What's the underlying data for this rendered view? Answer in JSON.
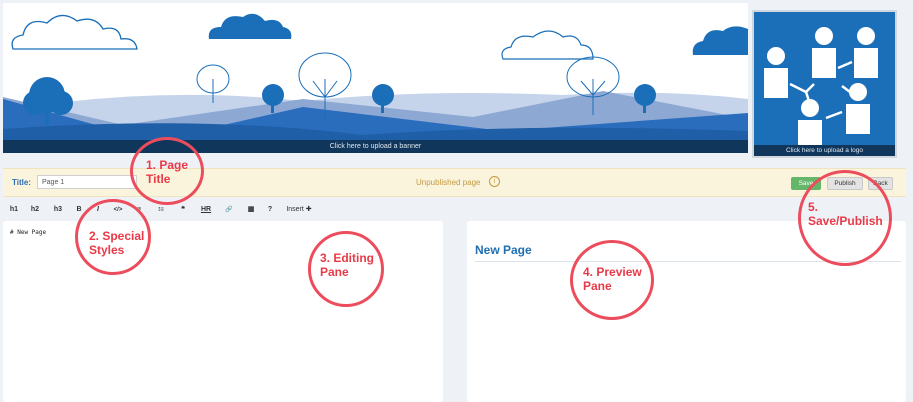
{
  "banner": {
    "upload_label": "Click here to upload a banner"
  },
  "logo": {
    "upload_label": "Click here to upload a logo"
  },
  "titlebar": {
    "label": "Title:",
    "title_value": "Page 1",
    "status": "Unpublished page",
    "info_icon": "i",
    "save_label": "Save",
    "publish_label": "Publish",
    "back_label": "Back"
  },
  "toolbar": {
    "items": [
      "h1",
      "h2",
      "h3",
      "B",
      "I",
      "</>",
      "≡",
      "⁝≡",
      "❝",
      "HR",
      "🔗",
      "▦",
      "?",
      "Insert ✚"
    ]
  },
  "editor": {
    "content": "# New Page"
  },
  "preview": {
    "heading": "New Page"
  },
  "annotations": {
    "a1": "1. Page\nTitle",
    "a2": "2. Special\nStyles",
    "a3": "3. Editing\nPane",
    "a4": "4. Preview\nPane",
    "a5": "5.\nSave/Publish"
  },
  "colors": {
    "accent_blue": "#1b6fb9",
    "annotation_red": "#ec4d5c",
    "save_green": "#66b66a",
    "status_gold": "#c29a45"
  }
}
